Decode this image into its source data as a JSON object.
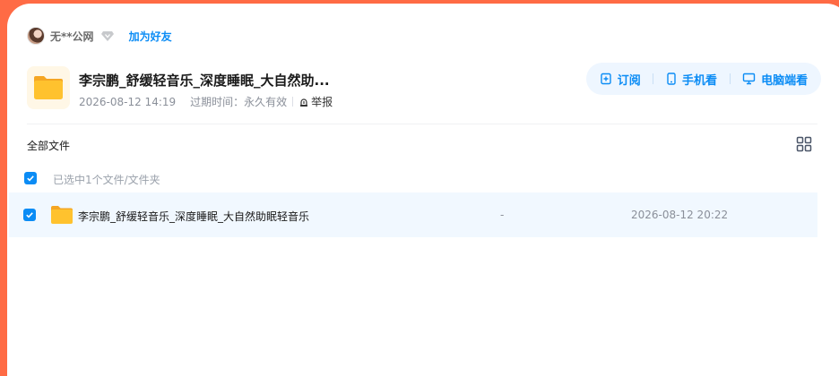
{
  "sharer": {
    "name": "无**公网",
    "add_friend": "加为好友"
  },
  "share": {
    "title": "李宗鹏_舒缓轻音乐_深度睡眠_大自然助...",
    "created": "2026-08-12 14:19",
    "expire_label": "过期时间：",
    "expire_value": "永久有效",
    "report": "举报"
  },
  "actions": {
    "subscribe": "订阅",
    "mobile": "手机看",
    "pc": "电脑端看"
  },
  "breadcrumb": "全部文件",
  "selection": {
    "summary": "已选中1个文件/文件夹"
  },
  "files": [
    {
      "name": "李宗鹏_舒缓轻音乐_深度睡眠_大自然助眠轻音乐",
      "size": "-",
      "modified": "2026-08-12 20:22",
      "checked": true
    }
  ],
  "colors": {
    "accent": "#0b8cf5",
    "frame": "#ff6b45",
    "row_highlight": "#f1f8ff",
    "folder": "#ffc22e"
  }
}
